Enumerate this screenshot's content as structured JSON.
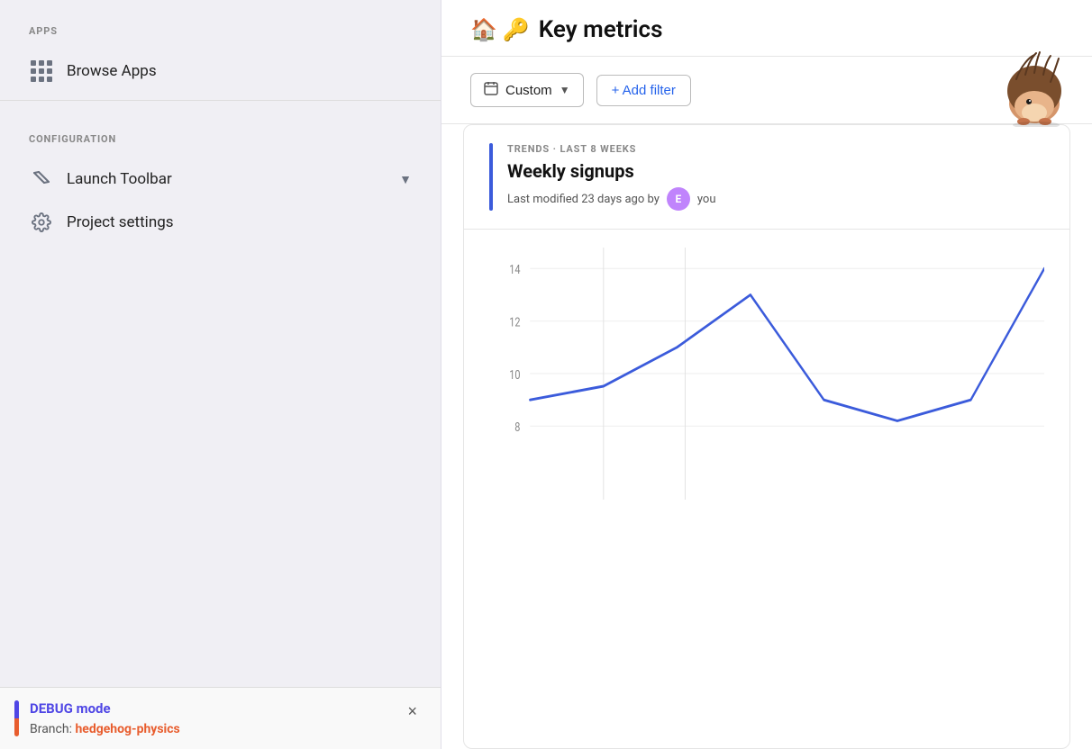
{
  "sidebar": {
    "apps_label": "APPS",
    "browse_apps": "Browse Apps",
    "config_label": "CONFIGURATION",
    "launch_toolbar": "Launch Toolbar",
    "project_settings": "Project settings"
  },
  "debug": {
    "title": "DEBUG mode",
    "branch_label": "Branch:",
    "branch_value": "hedgehog-physics",
    "close_icon": "×"
  },
  "header": {
    "home_icon": "🏠",
    "key_icon": "🔑",
    "title": "Key metrics"
  },
  "filters": {
    "custom_label": "Custom",
    "add_filter_label": "+ Add filter"
  },
  "chart": {
    "subtitle": "TRENDS · LAST 8 WEEKS",
    "title": "Weekly signups",
    "meta": "Last modified 23 days ago by",
    "author_initial": "E",
    "author_name": "you",
    "y_labels": [
      "8",
      "10",
      "12",
      "14"
    ],
    "data_points": [
      {
        "x": 0,
        "y": 9
      },
      {
        "x": 1,
        "y": 9.5
      },
      {
        "x": 2,
        "y": 11
      },
      {
        "x": 3,
        "y": 13
      },
      {
        "x": 4,
        "y": 9
      },
      {
        "x": 5,
        "y": 8.2
      },
      {
        "x": 6,
        "y": 9
      },
      {
        "x": 7,
        "y": 14
      }
    ]
  }
}
